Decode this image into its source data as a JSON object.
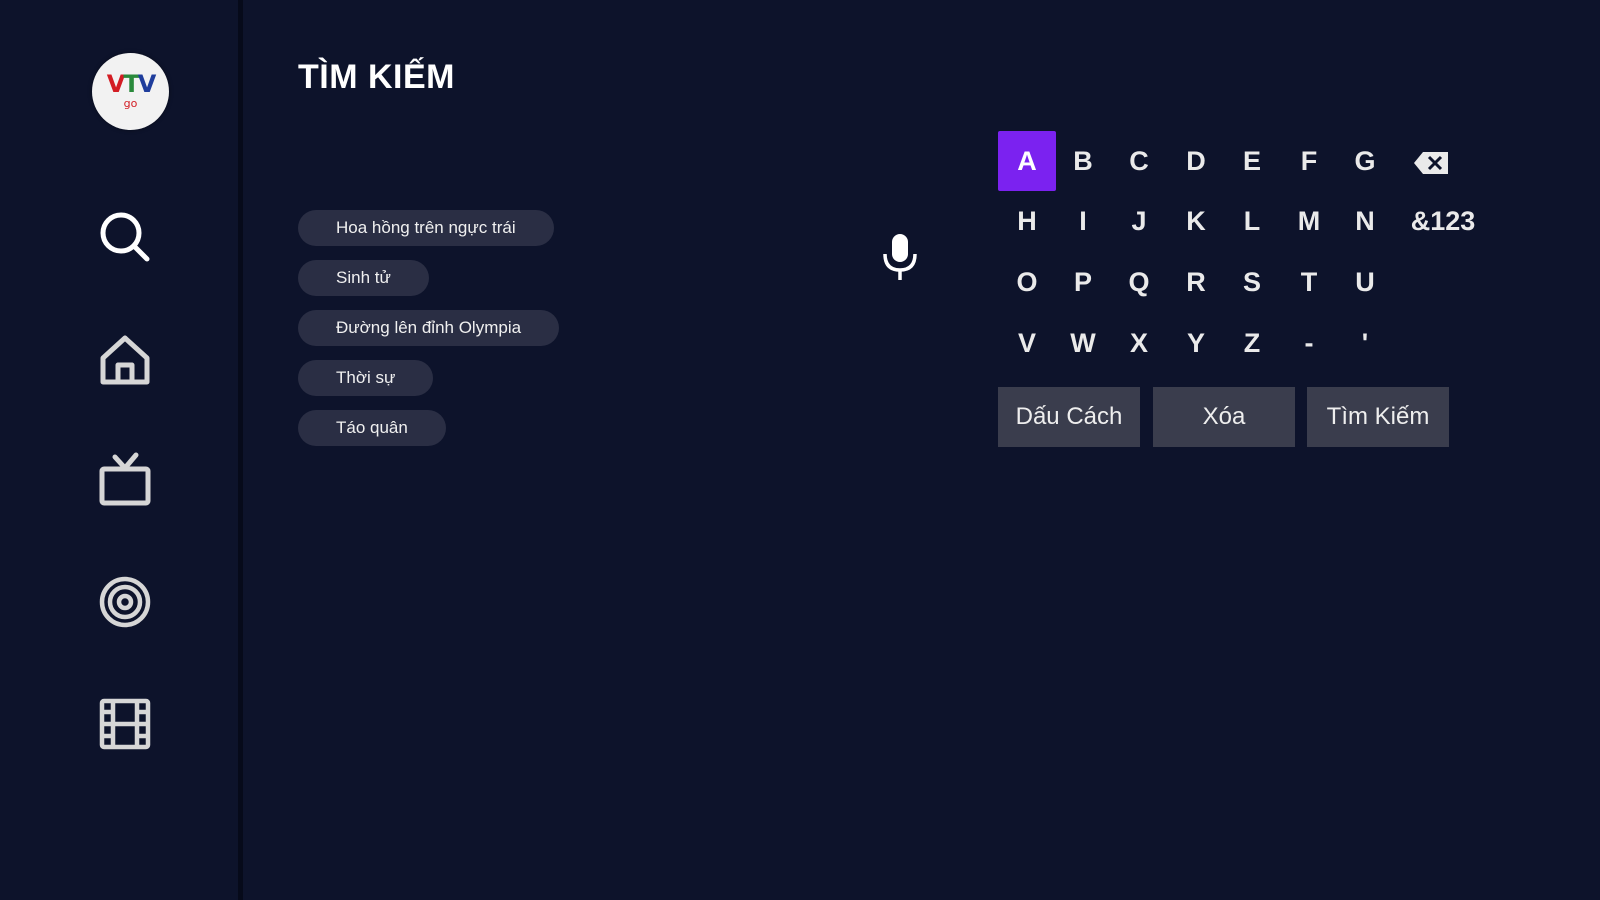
{
  "logo": {
    "line1_v1": "V",
    "line1_t": "T",
    "line1_v2": "V",
    "line2": "go"
  },
  "sidebar": {
    "items": [
      {
        "icon": "search-icon"
      },
      {
        "icon": "home-icon"
      },
      {
        "icon": "tv-icon"
      },
      {
        "icon": "live-target-icon"
      },
      {
        "icon": "film-icon"
      }
    ]
  },
  "page": {
    "title": "TÌM KIẾM"
  },
  "suggestions": [
    "Hoa hồng trên ngực trái",
    "Sinh tử",
    "Đường lên đỉnh Olympia",
    "Thời sự",
    "Táo quân"
  ],
  "keyboard": {
    "rows": [
      [
        "A",
        "B",
        "C",
        "D",
        "E",
        "F",
        "G"
      ],
      [
        "H",
        "I",
        "J",
        "K",
        "L",
        "M",
        "N"
      ],
      [
        "O",
        "P",
        "Q",
        "R",
        "S",
        "T",
        "U"
      ],
      [
        "V",
        "W",
        "X",
        "Y",
        "Z",
        "-",
        "'"
      ]
    ],
    "symbols_key": "&123",
    "space_label": "Dấu Cách",
    "delete_label": "Xóa",
    "search_label": "Tìm Kiếm",
    "highlight_color": "#7b22f0"
  }
}
